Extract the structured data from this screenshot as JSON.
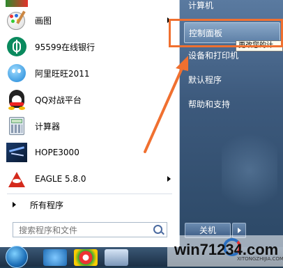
{
  "programs": [
    {
      "label": "画图",
      "has_arrow": true
    },
    {
      "label": "95599在线银行",
      "has_arrow": false
    },
    {
      "label": "阿里旺旺2011",
      "has_arrow": false
    },
    {
      "label": "QQ对战平台",
      "has_arrow": false
    },
    {
      "label": "计算器",
      "has_arrow": false
    },
    {
      "label": "HOPE3000",
      "has_arrow": false
    },
    {
      "label": "EAGLE 5.8.0",
      "has_arrow": true
    }
  ],
  "all_programs_label": "所有程序",
  "search": {
    "placeholder": "搜索程序和文件"
  },
  "right_items": {
    "computer": "计算机",
    "control_panel": "控制面板",
    "devices": "设备和打印机",
    "default_programs": "默认程序",
    "help": "帮助和支持"
  },
  "tooltip": "更改您的计",
  "shutdown_label": "关机",
  "watermark": {
    "main": "win71234.com",
    "sub": "XITONGZHIJIA.COM"
  },
  "colors": {
    "highlight": "#f07030",
    "annotation_arrow": "#f07030"
  },
  "icons": [
    "paint-icon",
    "bank-icon",
    "aliwangwang-icon",
    "qq-icon",
    "calculator-icon",
    "hope3000-icon",
    "eagle-icon"
  ]
}
